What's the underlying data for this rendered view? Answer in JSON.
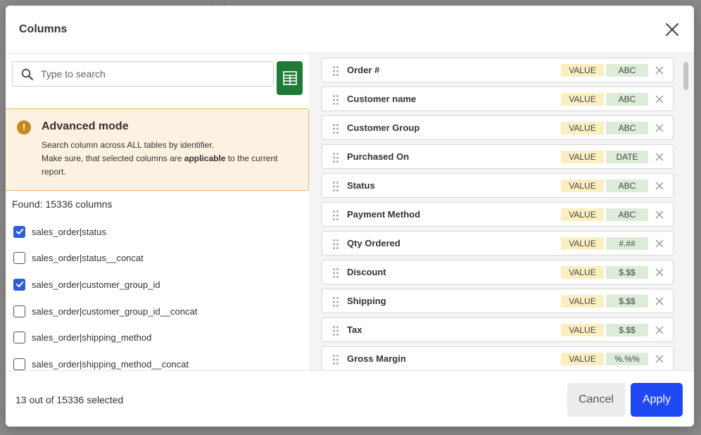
{
  "modal": {
    "title": "Columns",
    "close_icon": "close-icon"
  },
  "search": {
    "placeholder": "Type to search",
    "value": "",
    "icon": "search-icon",
    "grid_icon": "spreadsheet-icon",
    "grid_color": "#1f7a35"
  },
  "advanced": {
    "icon": "exclamation-icon",
    "title": "Advanced mode",
    "line1": "Search column across ALL tables by identifier.",
    "line2_pre": "Make sure, that selected columns are ",
    "line2_bold": "applicable",
    "line2_post": " to the current report."
  },
  "found_text": "Found: 15336 columns",
  "columns": [
    {
      "label": "sales_order|status",
      "checked": true
    },
    {
      "label": "sales_order|status__concat",
      "checked": false
    },
    {
      "label": "sales_order|customer_group_id",
      "checked": true
    },
    {
      "label": "sales_order|customer_group_id__concat",
      "checked": false
    },
    {
      "label": "sales_order|shipping_method",
      "checked": false
    },
    {
      "label": "sales_order|shipping_method__concat",
      "checked": false
    }
  ],
  "selected": [
    {
      "name": "Order #",
      "kind": "VALUE",
      "type": "ABC"
    },
    {
      "name": "Customer name",
      "kind": "VALUE",
      "type": "ABC"
    },
    {
      "name": "Customer Group",
      "kind": "VALUE",
      "type": "ABC"
    },
    {
      "name": "Purchased On",
      "kind": "VALUE",
      "type": "DATE"
    },
    {
      "name": "Status",
      "kind": "VALUE",
      "type": "ABC"
    },
    {
      "name": "Payment Method",
      "kind": "VALUE",
      "type": "ABC"
    },
    {
      "name": "Qty Ordered",
      "kind": "VALUE",
      "type": "#.##"
    },
    {
      "name": "Discount",
      "kind": "VALUE",
      "type": "$.$$"
    },
    {
      "name": "Shipping",
      "kind": "VALUE",
      "type": "$.$$"
    },
    {
      "name": "Tax",
      "kind": "VALUE",
      "type": "$.$$"
    },
    {
      "name": "Gross Margin",
      "kind": "VALUE",
      "type": "%.%%"
    }
  ],
  "footer": {
    "selected_count": "13 out of 15336 selected",
    "cancel_label": "Cancel",
    "apply_label": "Apply",
    "apply_color": "#1e49f5"
  }
}
